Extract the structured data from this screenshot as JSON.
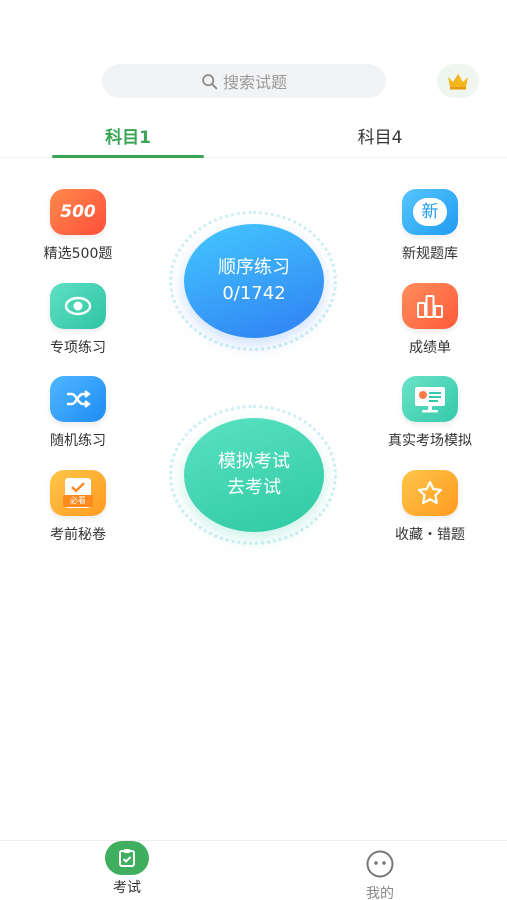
{
  "search": {
    "placeholder": "搜索试题"
  },
  "tabs": [
    {
      "label": "科目1",
      "active": true
    },
    {
      "label": "科目4",
      "active": false
    }
  ],
  "features_left": [
    {
      "label": "精选500题",
      "icon": "badge-500-icon",
      "icon_text": "500"
    },
    {
      "label": "专项练习",
      "icon": "target-eye-icon"
    },
    {
      "label": "随机练习",
      "icon": "shuffle-icon"
    },
    {
      "label": "考前秘卷",
      "icon": "must-read-book-icon",
      "icon_text": "必看"
    }
  ],
  "features_right": [
    {
      "label": "新规题库",
      "icon": "new-badge-icon",
      "icon_text": "新"
    },
    {
      "label": "成绩单",
      "icon": "score-chart-icon"
    },
    {
      "label": "真实考场模拟",
      "icon": "exam-screen-icon"
    },
    {
      "label": "收藏・错题",
      "icon": "star-icon"
    }
  ],
  "center": {
    "sequential": {
      "title": "顺序练习",
      "progress": "0/1742"
    },
    "mock_exam": {
      "title": "模拟考试",
      "subtitle": "去考试"
    }
  },
  "bottom_nav": [
    {
      "label": "考试",
      "icon": "exam-clipboard-icon",
      "active": true
    },
    {
      "label": "我的",
      "icon": "smiley-face-icon",
      "active": false
    }
  ],
  "colors": {
    "accent": "#3aa655",
    "inactive": "#888888"
  }
}
